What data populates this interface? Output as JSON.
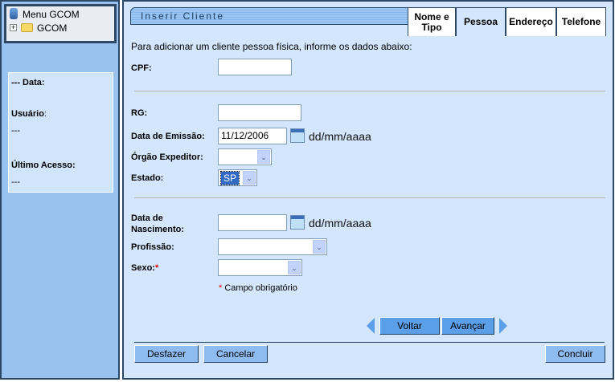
{
  "sidebar": {
    "menu_title": "Menu GCOM",
    "tree_item": "GCOM",
    "info": {
      "data_label": "--- Data:",
      "usuario_label": "Usuário",
      "usuario_colon": ":",
      "usuario_value": "---",
      "ultimo_acesso_label": "Último Acesso:",
      "ultimo_acesso_value": "---"
    }
  },
  "header": {
    "title": "Inserir Cliente"
  },
  "tabs": [
    {
      "label": "Nome e Tipo"
    },
    {
      "label": "Pessoa"
    },
    {
      "label": "Endereço"
    },
    {
      "label": "Telefone"
    }
  ],
  "form": {
    "intro": "Para adicionar um cliente pessoa física, informe os dados abaixo:",
    "cpf": {
      "label": "CPF:",
      "value": ""
    },
    "rg": {
      "label": "RG:",
      "value": ""
    },
    "data_emissao": {
      "label": "Data de Emissão:",
      "value": "11/12/2006",
      "format": "dd/mm/aaaa"
    },
    "orgao_expeditor": {
      "label": "Órgão Expeditor:",
      "value": ""
    },
    "estado": {
      "label": "Estado:",
      "value": "SP"
    },
    "data_nascimento": {
      "label1": "Data de",
      "label2": "Nascimento:",
      "value": "",
      "format": "dd/mm/aaaa"
    },
    "profissao": {
      "label": "Profissão:",
      "value": ""
    },
    "sexo": {
      "label": "Sexo:",
      "required_mark": "*",
      "value": ""
    },
    "required_note_mark": "*",
    "required_note": "Campo obrigatório"
  },
  "nav": {
    "back": "Voltar",
    "next": "Avançar"
  },
  "footer": {
    "undo": "Desfazer",
    "cancel": "Cancelar",
    "finish": "Concluir"
  },
  "colors": {
    "required": "#e00000",
    "panel": "#d3e6fb",
    "sidebar": "#99c2ef"
  }
}
